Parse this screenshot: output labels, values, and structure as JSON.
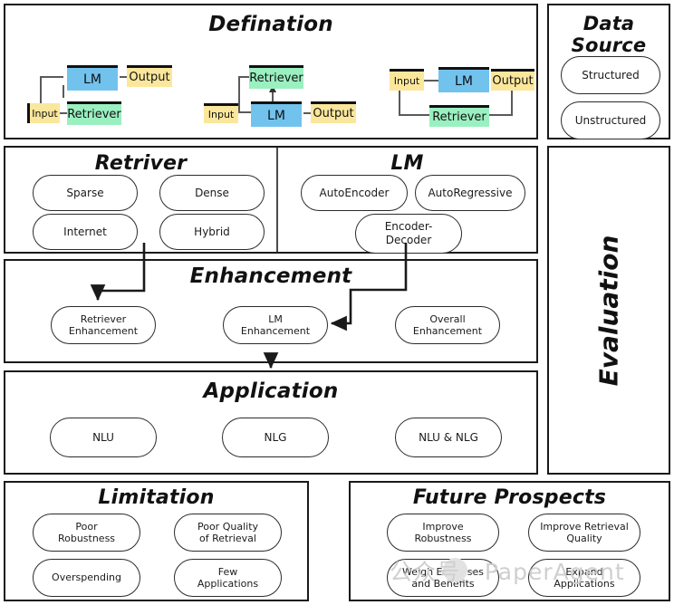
{
  "sections": {
    "defination": {
      "title": "Defination",
      "diagrams": [
        {
          "name": "retrieve-then-read",
          "nodes": [
            {
              "id": "lm",
              "label": "LM",
              "color": "#72c2ee"
            },
            {
              "id": "output",
              "label": "Output",
              "color": "#fbe79c"
            },
            {
              "id": "input",
              "label": "Input",
              "color": "#fbe79c"
            },
            {
              "id": "retriever",
              "label": "Retriever",
              "color": "#9af0c0"
            }
          ]
        },
        {
          "name": "generate-then-retrieve",
          "nodes": [
            {
              "id": "retriever",
              "label": "Retriever",
              "color": "#9af0c0"
            },
            {
              "id": "input",
              "label": "Input",
              "color": "#fbe79c"
            },
            {
              "id": "lm",
              "label": "LM",
              "color": "#72c2ee"
            },
            {
              "id": "output",
              "label": "Output",
              "color": "#fbe79c"
            }
          ]
        },
        {
          "name": "iterative-retrieval",
          "nodes": [
            {
              "id": "input",
              "label": "Input",
              "color": "#fbe79c"
            },
            {
              "id": "lm",
              "label": "LM",
              "color": "#72c2ee"
            },
            {
              "id": "output",
              "label": "Output",
              "color": "#fbe79c"
            },
            {
              "id": "retriever",
              "label": "Retriever",
              "color": "#9af0c0"
            }
          ]
        }
      ]
    },
    "data_source": {
      "title": "Data Source",
      "items": [
        {
          "label": "Structured"
        },
        {
          "label": "Unstructured"
        }
      ]
    },
    "retriver": {
      "title": "Retriver",
      "items": [
        {
          "label": "Sparse"
        },
        {
          "label": "Dense"
        },
        {
          "label": "Internet"
        },
        {
          "label": "Hybrid"
        }
      ]
    },
    "lm": {
      "title": "LM",
      "items": [
        {
          "label": "AutoEncoder"
        },
        {
          "label": "AutoRegressive"
        },
        {
          "label": "Encoder-\nDecoder"
        },
        {
          "label_line1": "Encoder-",
          "label_line2": "Decoder"
        }
      ]
    },
    "enhancement": {
      "title": "Enhancement",
      "items": [
        {
          "line1": "Retriever",
          "line2": "Enhancement"
        },
        {
          "line1": "LM",
          "line2": "Enhancement"
        },
        {
          "line1": "Overall",
          "line2": "Enhancement"
        }
      ]
    },
    "application": {
      "title": "Application",
      "items": [
        {
          "label": "NLU"
        },
        {
          "label": "NLG"
        },
        {
          "label": "NLU & NLG"
        }
      ]
    },
    "evaluation": {
      "title": "Evaluation"
    },
    "limitation": {
      "title": "Limitation",
      "items": [
        {
          "line1": "Poor",
          "line2": "Robustness"
        },
        {
          "line1": "Poor Quality",
          "line2": "of Retrieval"
        },
        {
          "line1": "Overspending",
          "line2": ""
        },
        {
          "line1": "Few",
          "line2": "Applications"
        }
      ]
    },
    "future_prospects": {
      "title": "Future Prospects",
      "items": [
        {
          "line1": "Improve",
          "line2": "Robustness"
        },
        {
          "line1": "Improve Retrieval",
          "line2": "Quality"
        },
        {
          "line1": "Weigh Expenses",
          "line2": "and Benefits"
        },
        {
          "line1": "Expand",
          "line2": "Applications"
        }
      ]
    }
  },
  "watermark": {
    "text": "公众号 ·  PaperAgent"
  },
  "colors": {
    "lm_blue": "#72c2ee",
    "retriever_green": "#9af0c0",
    "io_yellow": "#fbe79c",
    "border": "#1a1a1a",
    "connector": "#5a5a5a"
  }
}
